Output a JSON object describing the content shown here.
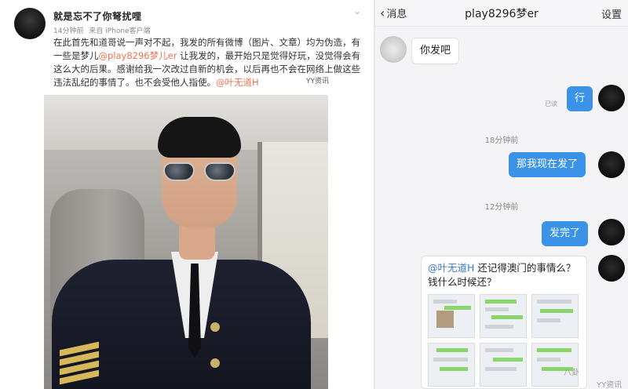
{
  "weibo": {
    "author": "就是忘不了你弩扰哩",
    "time": "14分钟前",
    "source": "来自 iPhone客户端",
    "text_a": "在此首先和道哥说一声对不起，我发的所有微博（图片、文章）均为伪造，有一些是梦儿",
    "mention1": "@play8296梦儿er",
    "text_b": " 让我发的，最开始只是觉得好玩，没觉得会有这么大的后果。感谢给我一次改过自新的机会，以后再也不会在网络上做这些违法乱纪的事情了。也不会受他人指使。",
    "mention2": "@叶无道H",
    "watermark": "YY资讯"
  },
  "chat": {
    "back_label": "消息",
    "title": "play8296梦er",
    "settings_label": "设置",
    "messages": [
      {
        "side": "in",
        "text": "你发吧"
      },
      {
        "side": "out",
        "text": "行",
        "status": "已读"
      },
      {
        "side": "out",
        "text": "那我现在发了"
      },
      {
        "side": "out",
        "text": "发完了"
      }
    ],
    "timestamps": [
      "18分钟前",
      "12分钟前"
    ],
    "card": {
      "mention": "@叶无道H",
      "text": " 还记得澳门的事情么？钱什么时候还？"
    },
    "watermark_a": "YY资讯",
    "watermark_b": "八卦"
  },
  "colors": {
    "out_bubble": "#3b93e8",
    "mention_weibo": "#eb7350",
    "mention_chat": "#3b79c9"
  }
}
